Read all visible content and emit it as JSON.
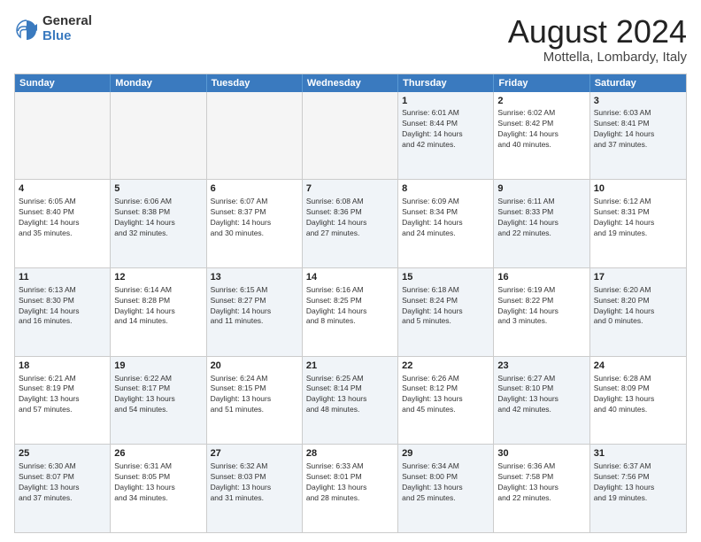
{
  "logo": {
    "general": "General",
    "blue": "Blue"
  },
  "title": {
    "month_year": "August 2024",
    "location": "Mottella, Lombardy, Italy"
  },
  "calendar": {
    "headers": [
      "Sunday",
      "Monday",
      "Tuesday",
      "Wednesday",
      "Thursday",
      "Friday",
      "Saturday"
    ],
    "rows": [
      [
        {
          "day": "",
          "text": "",
          "empty": true
        },
        {
          "day": "",
          "text": "",
          "empty": true
        },
        {
          "day": "",
          "text": "",
          "empty": true
        },
        {
          "day": "",
          "text": "",
          "empty": true
        },
        {
          "day": "1",
          "text": "Sunrise: 6:01 AM\nSunset: 8:44 PM\nDaylight: 14 hours\nand 42 minutes."
        },
        {
          "day": "2",
          "text": "Sunrise: 6:02 AM\nSunset: 8:42 PM\nDaylight: 14 hours\nand 40 minutes."
        },
        {
          "day": "3",
          "text": "Sunrise: 6:03 AM\nSunset: 8:41 PM\nDaylight: 14 hours\nand 37 minutes."
        }
      ],
      [
        {
          "day": "4",
          "text": "Sunrise: 6:05 AM\nSunset: 8:40 PM\nDaylight: 14 hours\nand 35 minutes."
        },
        {
          "day": "5",
          "text": "Sunrise: 6:06 AM\nSunset: 8:38 PM\nDaylight: 14 hours\nand 32 minutes."
        },
        {
          "day": "6",
          "text": "Sunrise: 6:07 AM\nSunset: 8:37 PM\nDaylight: 14 hours\nand 30 minutes."
        },
        {
          "day": "7",
          "text": "Sunrise: 6:08 AM\nSunset: 8:36 PM\nDaylight: 14 hours\nand 27 minutes."
        },
        {
          "day": "8",
          "text": "Sunrise: 6:09 AM\nSunset: 8:34 PM\nDaylight: 14 hours\nand 24 minutes."
        },
        {
          "day": "9",
          "text": "Sunrise: 6:11 AM\nSunset: 8:33 PM\nDaylight: 14 hours\nand 22 minutes."
        },
        {
          "day": "10",
          "text": "Sunrise: 6:12 AM\nSunset: 8:31 PM\nDaylight: 14 hours\nand 19 minutes."
        }
      ],
      [
        {
          "day": "11",
          "text": "Sunrise: 6:13 AM\nSunset: 8:30 PM\nDaylight: 14 hours\nand 16 minutes."
        },
        {
          "day": "12",
          "text": "Sunrise: 6:14 AM\nSunset: 8:28 PM\nDaylight: 14 hours\nand 14 minutes."
        },
        {
          "day": "13",
          "text": "Sunrise: 6:15 AM\nSunset: 8:27 PM\nDaylight: 14 hours\nand 11 minutes."
        },
        {
          "day": "14",
          "text": "Sunrise: 6:16 AM\nSunset: 8:25 PM\nDaylight: 14 hours\nand 8 minutes."
        },
        {
          "day": "15",
          "text": "Sunrise: 6:18 AM\nSunset: 8:24 PM\nDaylight: 14 hours\nand 5 minutes."
        },
        {
          "day": "16",
          "text": "Sunrise: 6:19 AM\nSunset: 8:22 PM\nDaylight: 14 hours\nand 3 minutes."
        },
        {
          "day": "17",
          "text": "Sunrise: 6:20 AM\nSunset: 8:20 PM\nDaylight: 14 hours\nand 0 minutes."
        }
      ],
      [
        {
          "day": "18",
          "text": "Sunrise: 6:21 AM\nSunset: 8:19 PM\nDaylight: 13 hours\nand 57 minutes."
        },
        {
          "day": "19",
          "text": "Sunrise: 6:22 AM\nSunset: 8:17 PM\nDaylight: 13 hours\nand 54 minutes."
        },
        {
          "day": "20",
          "text": "Sunrise: 6:24 AM\nSunset: 8:15 PM\nDaylight: 13 hours\nand 51 minutes."
        },
        {
          "day": "21",
          "text": "Sunrise: 6:25 AM\nSunset: 8:14 PM\nDaylight: 13 hours\nand 48 minutes."
        },
        {
          "day": "22",
          "text": "Sunrise: 6:26 AM\nSunset: 8:12 PM\nDaylight: 13 hours\nand 45 minutes."
        },
        {
          "day": "23",
          "text": "Sunrise: 6:27 AM\nSunset: 8:10 PM\nDaylight: 13 hours\nand 42 minutes."
        },
        {
          "day": "24",
          "text": "Sunrise: 6:28 AM\nSunset: 8:09 PM\nDaylight: 13 hours\nand 40 minutes."
        }
      ],
      [
        {
          "day": "25",
          "text": "Sunrise: 6:30 AM\nSunset: 8:07 PM\nDaylight: 13 hours\nand 37 minutes."
        },
        {
          "day": "26",
          "text": "Sunrise: 6:31 AM\nSunset: 8:05 PM\nDaylight: 13 hours\nand 34 minutes."
        },
        {
          "day": "27",
          "text": "Sunrise: 6:32 AM\nSunset: 8:03 PM\nDaylight: 13 hours\nand 31 minutes."
        },
        {
          "day": "28",
          "text": "Sunrise: 6:33 AM\nSunset: 8:01 PM\nDaylight: 13 hours\nand 28 minutes."
        },
        {
          "day": "29",
          "text": "Sunrise: 6:34 AM\nSunset: 8:00 PM\nDaylight: 13 hours\nand 25 minutes."
        },
        {
          "day": "30",
          "text": "Sunrise: 6:36 AM\nSunset: 7:58 PM\nDaylight: 13 hours\nand 22 minutes."
        },
        {
          "day": "31",
          "text": "Sunrise: 6:37 AM\nSunset: 7:56 PM\nDaylight: 13 hours\nand 19 minutes."
        }
      ]
    ]
  }
}
